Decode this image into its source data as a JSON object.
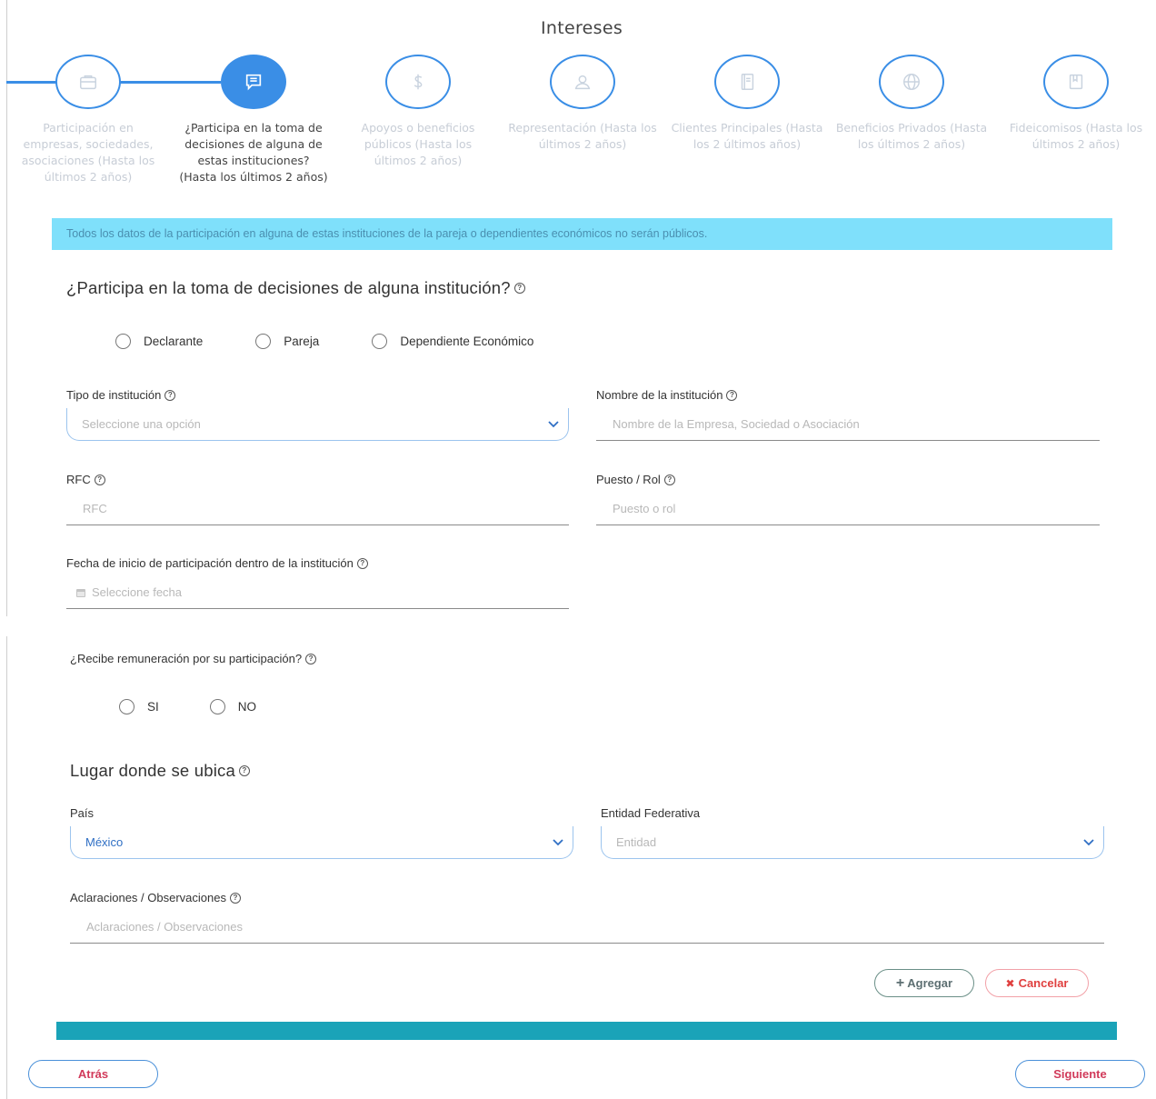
{
  "page": {
    "title": "Intereses"
  },
  "steps": [
    {
      "icon": "briefcase-icon",
      "label": "Participación en empresas, sociedades, asociaciones (Hasta los últimos 2 años)",
      "active": false
    },
    {
      "icon": "chat-icon",
      "label": "¿Participa en la toma de decisiones de alguna de estas instituciones? (Hasta los últimos 2 años)",
      "active": true
    },
    {
      "icon": "dollar-icon",
      "label": "Apoyos o beneficios públicos (Hasta los últimos 2 años)",
      "active": false
    },
    {
      "icon": "user-icon",
      "label": "Representación (Hasta los últimos 2 años)",
      "active": false
    },
    {
      "icon": "notebook-icon",
      "label": "Clientes Principales (Hasta los 2 últimos años)",
      "active": false
    },
    {
      "icon": "globe-icon",
      "label": "Beneficios Privados (Hasta los últimos 2 años)",
      "active": false
    },
    {
      "icon": "book-icon",
      "label": "Fideicomisos (Hasta los últimos 2 años)",
      "active": false
    }
  ],
  "alert": {
    "text": "Todos los datos de la participación en alguna de estas instituciones de la pareja o dependientes económicos no serán públicos."
  },
  "decision": {
    "title": "¿Participa en la toma de decisiones de alguna institución?",
    "options": [
      "Declarante",
      "Pareja",
      "Dependiente Económico"
    ]
  },
  "form": {
    "tipo": {
      "label": "Tipo de institución",
      "placeholder": "Seleccione una opción"
    },
    "nombre": {
      "label": "Nombre de la institución",
      "placeholder": "Nombre de la Empresa, Sociedad o Asociación"
    },
    "rfc": {
      "label": "RFC",
      "placeholder": "RFC"
    },
    "puesto": {
      "label": "Puesto / Rol",
      "placeholder": "Puesto o rol"
    },
    "fecha": {
      "label": "Fecha de inicio de participación dentro de la institución",
      "placeholder": "Seleccione fecha"
    },
    "remuneracion": {
      "label": "¿Recibe remuneración por su participación?",
      "options": [
        "SI",
        "NO"
      ]
    }
  },
  "ubicacion": {
    "title": "Lugar donde se ubica",
    "pais": {
      "label": "País",
      "value": "México"
    },
    "entidad": {
      "label": "Entidad Federativa",
      "placeholder": "Entidad"
    },
    "aclaraciones": {
      "label": "Aclaraciones / Observaciones",
      "placeholder": "Aclaraciones / Observaciones"
    }
  },
  "actions": {
    "add": "Agregar",
    "cancel": "Cancelar",
    "back": "Atrás",
    "next": "Siguiente"
  },
  "colors": {
    "primary": "#3a8ee6",
    "alert_bg": "#7fe0fb",
    "bar": "#1aa3b8",
    "danger": "#e0403f"
  }
}
